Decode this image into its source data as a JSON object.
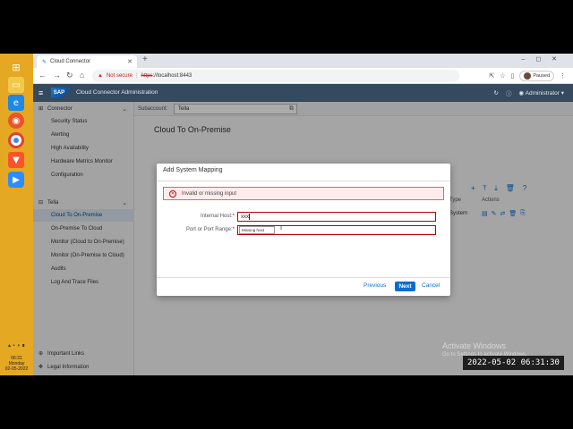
{
  "taskbar": {
    "icons": [
      "windows-start-icon",
      "file-explorer-icon",
      "internet-explorer-icon",
      "firefox-icon",
      "chrome-icon",
      "brave-icon",
      "zoom-icon"
    ],
    "clock_time": "06:31",
    "clock_day": "Monday",
    "clock_date": "02-05-2022"
  },
  "browser": {
    "tab_title": "Cloud Connector",
    "not_secure_label": "Not secure",
    "url_scheme": "https",
    "url_rest": "://localhost:8443",
    "profile_status": "Paused"
  },
  "header": {
    "app_title": "Cloud Connector Administration",
    "user": "Administrator",
    "logo_text": "SAP"
  },
  "sidebar": {
    "groups": [
      {
        "label": "Connector",
        "items": [
          "Security Status",
          "Alerting",
          "High Availability",
          "Hardware Metrics Monitor",
          "Configuration"
        ]
      },
      {
        "label": "Tella",
        "items": [
          "Cloud To On-Premise",
          "On-Premise To Cloud",
          "Monitor (Cloud to On-Premise)",
          "Monitor (On-Premise to Cloud)",
          "Audits",
          "Log And Trace Files"
        ]
      }
    ],
    "bottom": [
      "Important Links",
      "Legal Information"
    ]
  },
  "main": {
    "subaccount_label": "Subaccount:",
    "subaccount_value": "Tella",
    "page_title": "Cloud To On-Premise",
    "table_headers": [
      "Type",
      "Actions"
    ],
    "table_row_type": "System"
  },
  "dialog": {
    "title": "Add System Mapping",
    "error_message": "Invalid or missing input",
    "internal_host_label": "Internal Host:",
    "internal_host_value": "xxx",
    "port_label": "Port or Port Range:",
    "tooltip": "Missing host",
    "previous_label": "Previous",
    "next_label": "Next",
    "cancel_label": "Cancel"
  },
  "watermark": {
    "line1": "Activate Windows",
    "line2": "Go to Settings to activate Windows."
  },
  "timestamp": "2022-05-02  06:31:30",
  "colors": {
    "taskbar": "#e5a822",
    "sap_header": "#354a5f",
    "accent": "#0a6ed1",
    "error": "#bb0000"
  }
}
